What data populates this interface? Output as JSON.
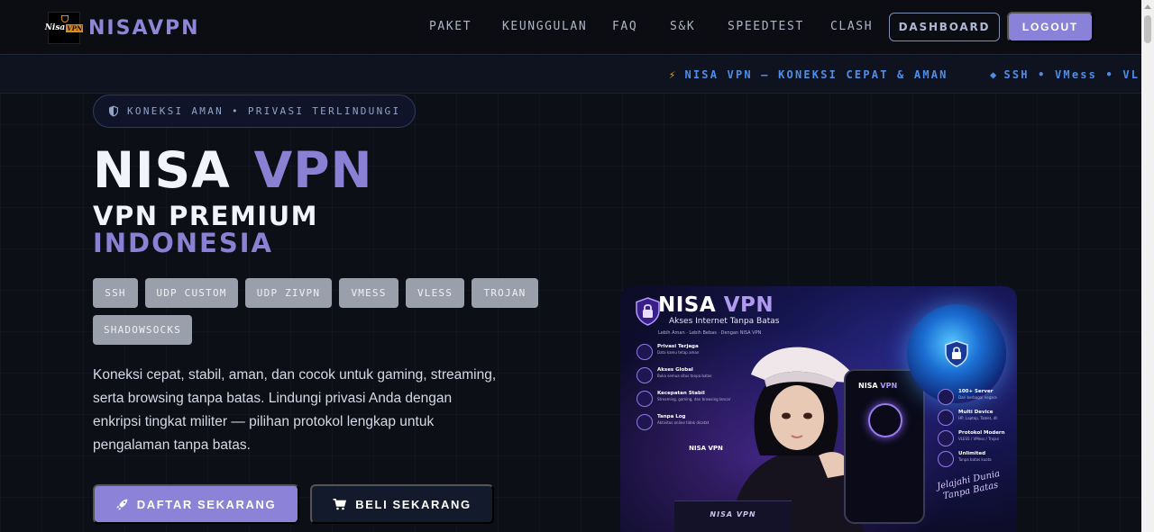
{
  "brand": {
    "logo_text_left": "Nisa",
    "logo_text_right": "VPN",
    "name": "NISAVPN"
  },
  "nav": {
    "links": [
      "PAKET",
      "KEUNGGULAN",
      "FAQ",
      "S&K",
      "SPEEDTEST",
      "CLASH"
    ],
    "dashboard_label": "DASHBOARD",
    "logout_label": "LOGOUT"
  },
  "ticker": {
    "items": [
      "NISA VPN — KONEKSI CEPAT & AMAN",
      "SSH • VMess • VL"
    ]
  },
  "hero": {
    "badge": "KONEKSI AMAN • PRIVASI TERLINDUNGI",
    "title_word1": "NISA",
    "title_word2": "VPN",
    "subtitle_line1": "VPN PREMIUM",
    "subtitle_line2": "INDONESIA",
    "protocols": [
      "SSH",
      "UDP CUSTOM",
      "UDP ZIVPN",
      "VMESS",
      "VLESS",
      "TROJAN",
      "SHADOWSOCKS"
    ],
    "description": "Koneksi cepat, stabil, aman, dan cocok untuk gaming, streaming, serta browsing tanpa batas. Lindungi privasi Anda dengan enkripsi tingkat militer — pilihan protokol lengkap untuk pengalaman tanpa batas.",
    "cta_primary": "DAFTAR SEKARANG",
    "cta_secondary": "BELI SEKARANG"
  },
  "promo_image": {
    "title_a": "NISA",
    "title_b": "VPN",
    "subtitle": "Akses Internet Tanpa Batas",
    "tagline": "Lebih Aman · Lebih Bebas · Dengan NISA VPN",
    "features_left": [
      {
        "title": "Privasi Terjaga",
        "desc": "Data kamu tetap aman"
      },
      {
        "title": "Akses Global",
        "desc": "Buka semua situs tanpa batas"
      },
      {
        "title": "Kecepatan Stabil",
        "desc": "Streaming, gaming, dan browsing lancar"
      },
      {
        "title": "Tanpa Log",
        "desc": "Aktivitas online tidak dicatat"
      }
    ],
    "features_right": [
      {
        "title": "100+ Server",
        "desc": "Dari berbagai negara"
      },
      {
        "title": "Multi Device",
        "desc": "HP, Laptop, Tablet, dll"
      },
      {
        "title": "Protokol Modern",
        "desc": "VLESS / VMess / Trojan"
      },
      {
        "title": "Unlimited",
        "desc": "Tanpa batas kuota"
      }
    ],
    "phone_title_a": "NISA",
    "phone_title_b": "VPN",
    "hoodie_text": "NISA VPN",
    "laptop_text": "NISA VPN",
    "script_line1": "Jelajahi Dunia",
    "script_line2": "Tanpa Batas"
  },
  "colors": {
    "accent": "#8c80d4",
    "ticker_text": "#4e8ee8",
    "chip_bg": "#9aa0ab",
    "background": "#0d0f16"
  }
}
